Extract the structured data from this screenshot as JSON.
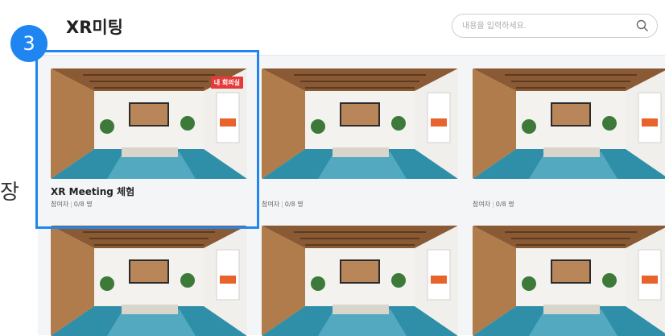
{
  "page": {
    "title": "XR미팅",
    "side_text": "장"
  },
  "search": {
    "placeholder": "내용을 입력하세요."
  },
  "step_marker": "3",
  "rooms": [
    {
      "name": "XR Meeting 체험",
      "participants_label": "참여자",
      "participants_count": "0/8 명",
      "badge": "내 회의실"
    },
    {
      "name": "",
      "participants_label": "참여자",
      "participants_count": "0/8 명"
    },
    {
      "name": "",
      "participants_label": "참여자",
      "participants_count": "0/8 명"
    },
    {
      "name": "",
      "participants_label": "",
      "participants_count": ""
    },
    {
      "name": "",
      "participants_label": "",
      "participants_count": ""
    },
    {
      "name": "",
      "participants_label": "",
      "participants_count": ""
    }
  ],
  "colors": {
    "accent": "#1f86f1",
    "badge": "#e63a3a",
    "floor": "#2f8fa8",
    "wall": "#e8e6e2",
    "ceiling_wood": "#8a5a34"
  }
}
